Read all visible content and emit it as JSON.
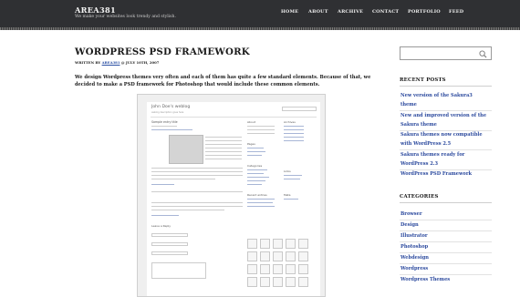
{
  "site": {
    "title": "AREA381",
    "tagline": "We make your websites look trendy and stylish."
  },
  "nav": [
    {
      "label": "HOME"
    },
    {
      "label": "ABOUT"
    },
    {
      "label": "ARCHIVE"
    },
    {
      "label": "CONTACT"
    },
    {
      "label": "PORTFOLIO"
    },
    {
      "label": "FEED"
    }
  ],
  "post": {
    "title": "WORDPRESS PSD FRAMEWORK",
    "byline_prefix": "WRITTEN BY",
    "author": "AREA381",
    "date": "@ JULY 10TH, 2007",
    "intro": "We design Wordpress themes very often and each of them has quite a few standard elements. Because of that, we decided to make a PSD framework for Photoshop that would include these common elements."
  },
  "preview": {
    "blog_title": "John Doe's weblog",
    "blog_desc": "weblog description goes here",
    "post_title": "Sample entry title",
    "col_about": "About",
    "col_archives": "Archives",
    "col_pages": "Pages",
    "col_categories": "Categories",
    "col_links": "Links",
    "col_recent": "Recent entries",
    "col_meta": "Meta",
    "reply_title": "Leave a Reply"
  },
  "sidebar": {
    "search": {
      "placeholder": ""
    },
    "recent_posts_heading": "RECENT POSTS",
    "recent_posts": [
      {
        "line1": "New version of the Sakura3",
        "line2": "theme"
      },
      {
        "line1": "New and improved version of the",
        "line2": "Sakura theme"
      },
      {
        "line1": "Sakura themes now compatible",
        "line2": "with WordPress 2.5"
      },
      {
        "line1": "Sakura themes ready for",
        "line2": "WordPress 2.3"
      },
      {
        "line1": "WordPress PSD Framework",
        "line2": ""
      }
    ],
    "categories_heading": "CATEGORIES",
    "categories": [
      {
        "label": "Browser"
      },
      {
        "label": "Design"
      },
      {
        "label": "Illustrator"
      },
      {
        "label": "Photoshop"
      },
      {
        "label": "Webdesign"
      },
      {
        "label": "Wordpress"
      },
      {
        "label": "Wordpress Themes"
      }
    ]
  },
  "colors": {
    "header_bg": "#2f3033",
    "link": "#2c4a9e",
    "text": "#1a1a1a"
  },
  "icons": {
    "search": "search-icon"
  }
}
